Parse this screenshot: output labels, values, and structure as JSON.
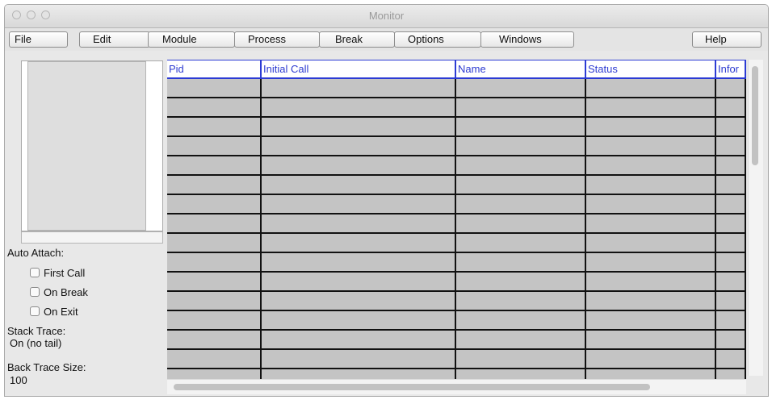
{
  "window": {
    "title": "Monitor"
  },
  "menubar": {
    "items": [
      {
        "label": "File"
      },
      {
        "label": "Edit"
      },
      {
        "label": "Module"
      },
      {
        "label": "Process"
      },
      {
        "label": "Break"
      },
      {
        "label": "Options"
      },
      {
        "label": "Windows"
      },
      {
        "label": "Help"
      }
    ]
  },
  "sidebar": {
    "auto_attach_label": "Auto Attach:",
    "checkboxes": [
      {
        "label": "First Call",
        "checked": false
      },
      {
        "label": "On Break",
        "checked": false
      },
      {
        "label": "On Exit",
        "checked": false
      }
    ],
    "stack_trace_label": "Stack Trace:",
    "stack_trace_value": "On (no tail)",
    "back_trace_label": "Back Trace Size:",
    "back_trace_value": "100"
  },
  "table": {
    "columns": [
      {
        "label": "Pid"
      },
      {
        "label": "Initial Call"
      },
      {
        "label": "Name"
      },
      {
        "label": "Status"
      },
      {
        "label": "Infor"
      }
    ],
    "rows": [
      [
        "",
        "",
        "",
        "",
        ""
      ],
      [
        "",
        "",
        "",
        "",
        ""
      ],
      [
        "",
        "",
        "",
        "",
        ""
      ],
      [
        "",
        "",
        "",
        "",
        ""
      ],
      [
        "",
        "",
        "",
        "",
        ""
      ],
      [
        "",
        "",
        "",
        "",
        ""
      ],
      [
        "",
        "",
        "",
        "",
        ""
      ],
      [
        "",
        "",
        "",
        "",
        ""
      ],
      [
        "",
        "",
        "",
        "",
        ""
      ],
      [
        "",
        "",
        "",
        "",
        ""
      ],
      [
        "",
        "",
        "",
        "",
        ""
      ],
      [
        "",
        "",
        "",
        "",
        ""
      ],
      [
        "",
        "",
        "",
        "",
        ""
      ],
      [
        "",
        "",
        "",
        "",
        ""
      ],
      [
        "",
        "",
        "",
        "",
        ""
      ],
      [
        "",
        "",
        "",
        "",
        ""
      ]
    ]
  },
  "colors": {
    "header_text": "#2d3bd1",
    "header_border": "#2c3bd4",
    "cell_background": "#c4c4c4",
    "grid_line": "#111111"
  }
}
